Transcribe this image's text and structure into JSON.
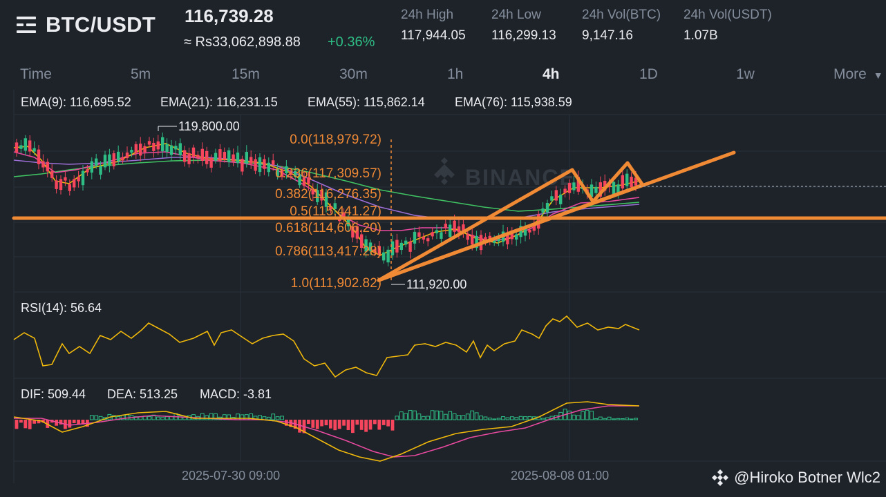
{
  "header": {
    "pair": "BTC/USDT",
    "price": "116,739.28",
    "fiat_price": "≈ Rs33,062,898.88",
    "change": "+0.36%",
    "stats": [
      {
        "label": "24h High",
        "value": "117,944.05"
      },
      {
        "label": "24h Low",
        "value": "116,299.13"
      },
      {
        "label": "24h Vol(BTC)",
        "value": "9,147.16"
      },
      {
        "label": "24h Vol(USDT)",
        "value": "1.07B"
      }
    ]
  },
  "timeframes": [
    "Time",
    "5m",
    "15m",
    "30m",
    "1h",
    "4h",
    "1D",
    "1w",
    "More"
  ],
  "active_timeframe": "4h",
  "indicators": {
    "ema": [
      {
        "label": "EMA(9): 116,695.52",
        "color": "#f0b90b"
      },
      {
        "label": "EMA(21): 116,231.15",
        "color": "#e84aa0"
      },
      {
        "label": "EMA(55): 115,862.14",
        "color": "#9b6fd6"
      },
      {
        "label": "EMA(76): 115,938.59",
        "color": "#40c463"
      }
    ],
    "rsi": {
      "label": "RSI(14): 56.64",
      "color": "#f0b90b"
    },
    "macd": [
      {
        "label": "DIF: 509.44",
        "color": "#f0b90b"
      },
      {
        "label": "DEA: 513.25",
        "color": "#e84aa0"
      },
      {
        "label": "MACD: -3.81",
        "color": "#9b6fd6"
      }
    ]
  },
  "chart_annotations": {
    "high_marker": "119,800.00",
    "low_marker": "111,920.00",
    "fib_levels": [
      "0.0(118,979.72)",
      "0.236(117,309.57)",
      "0.382(116,276.35)",
      "0.5(115,441.27)",
      "0.618(114,606.20)",
      "0.786(113,417.28)",
      "1.0(111,902.82)"
    ],
    "logo_text": "BINANCE"
  },
  "x_axis_labels": [
    "2025-07-30 09:00",
    "2025-08-08 01:00"
  ],
  "watermark": "@Hiroko Botner Wlc2",
  "colors": {
    "up": "#2ebd85",
    "down": "#f6465d",
    "drawing": "#f08a35",
    "fib": "#f08a35",
    "background": "#1e2229"
  }
}
